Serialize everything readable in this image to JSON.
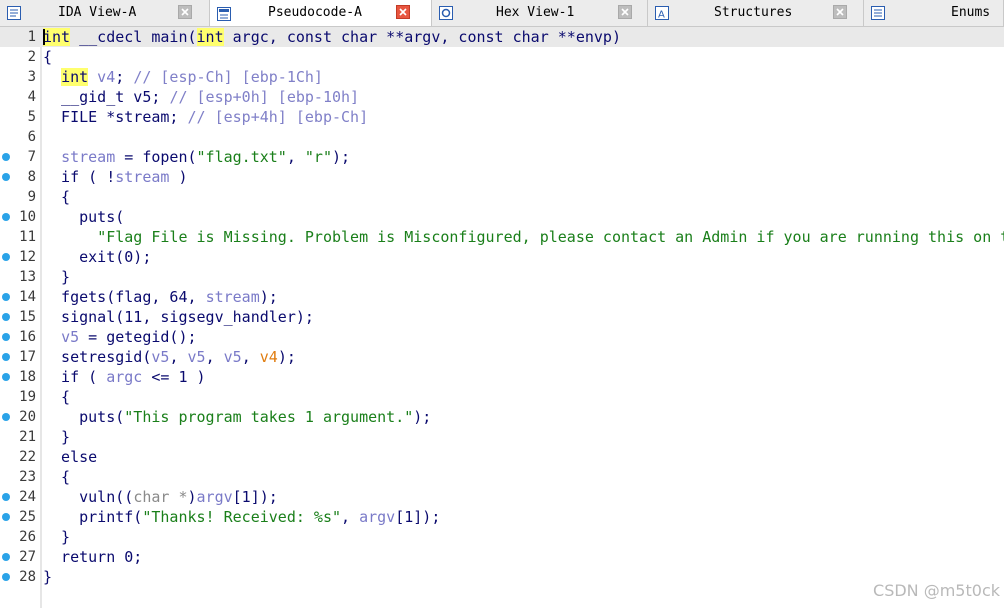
{
  "tabs": [
    {
      "label": "IDA View-A",
      "icon": "disassembly-view-icon",
      "close": "grey"
    },
    {
      "label": "Pseudocode-A",
      "icon": "pseudocode-icon",
      "close": "red",
      "active": true
    },
    {
      "label": "Hex View-1",
      "icon": "hex-view-icon",
      "close": "grey"
    },
    {
      "label": "Structures",
      "icon": "structures-icon",
      "close": "grey"
    },
    {
      "label": "Enums",
      "icon": "enums-icon",
      "close": "grey"
    }
  ],
  "colors": {
    "keyword_bg": "#ffff6e",
    "string": "#1a7f1a",
    "comment": "#8080c8",
    "breakpoint": "#2aa3e8",
    "close_active": "#e8553f"
  },
  "code": {
    "lines": [
      {
        "n": "1",
        "bp": false,
        "current": true,
        "tokens": [
          [
            "kw",
            "int"
          ],
          [
            "plain",
            " __cdecl main("
          ],
          [
            "kw",
            "int"
          ],
          [
            "plain",
            " argc, const char **argv, const char **envp)"
          ]
        ]
      },
      {
        "n": "2",
        "bp": false,
        "tokens": [
          [
            "plain",
            "{"
          ]
        ]
      },
      {
        "n": "3",
        "bp": false,
        "tokens": [
          [
            "plain",
            "  "
          ],
          [
            "kw",
            "int"
          ],
          [
            "var",
            " v4"
          ],
          [
            "plain",
            "; "
          ],
          [
            "cmt",
            "// [esp-Ch] [ebp-1Ch]"
          ]
        ]
      },
      {
        "n": "4",
        "bp": false,
        "tokens": [
          [
            "plain",
            "  __gid_t v5; "
          ],
          [
            "cmt",
            "// [esp+0h] [ebp-10h]"
          ]
        ]
      },
      {
        "n": "5",
        "bp": false,
        "tokens": [
          [
            "plain",
            "  FILE *stream; "
          ],
          [
            "cmt",
            "// [esp+4h] [ebp-Ch]"
          ]
        ]
      },
      {
        "n": "6",
        "bp": false,
        "tokens": []
      },
      {
        "n": "7",
        "bp": true,
        "tokens": [
          [
            "plain",
            "  "
          ],
          [
            "var",
            "stream"
          ],
          [
            "plain",
            " = fopen("
          ],
          [
            "str",
            "\"flag.txt\""
          ],
          [
            "plain",
            ", "
          ],
          [
            "str",
            "\"r\""
          ],
          [
            "plain",
            ");"
          ]
        ]
      },
      {
        "n": "8",
        "bp": true,
        "tokens": [
          [
            "plain",
            "  if ( !"
          ],
          [
            "var",
            "stream"
          ],
          [
            "plain",
            " )"
          ]
        ]
      },
      {
        "n": "9",
        "bp": false,
        "tokens": [
          [
            "plain",
            "  {"
          ]
        ]
      },
      {
        "n": "10",
        "bp": true,
        "tokens": [
          [
            "plain",
            "    puts("
          ]
        ]
      },
      {
        "n": "11",
        "bp": false,
        "tokens": [
          [
            "plain",
            "      "
          ],
          [
            "str",
            "\"Flag File is Missing. Problem is Misconfigured, please contact an Admin if you are running this on t"
          ]
        ]
      },
      {
        "n": "12",
        "bp": true,
        "tokens": [
          [
            "plain",
            "    exit(0);"
          ]
        ]
      },
      {
        "n": "13",
        "bp": false,
        "tokens": [
          [
            "plain",
            "  }"
          ]
        ]
      },
      {
        "n": "14",
        "bp": true,
        "tokens": [
          [
            "plain",
            "  fgets(flag, 64, "
          ],
          [
            "var",
            "stream"
          ],
          [
            "plain",
            ");"
          ]
        ]
      },
      {
        "n": "15",
        "bp": true,
        "tokens": [
          [
            "plain",
            "  signal(11, sigsegv_handler);"
          ]
        ]
      },
      {
        "n": "16",
        "bp": true,
        "tokens": [
          [
            "plain",
            "  "
          ],
          [
            "var",
            "v5"
          ],
          [
            "plain",
            " = getegid();"
          ]
        ]
      },
      {
        "n": "17",
        "bp": true,
        "tokens": [
          [
            "plain",
            "  setresgid("
          ],
          [
            "var",
            "v5"
          ],
          [
            "plain",
            ", "
          ],
          [
            "var",
            "v5"
          ],
          [
            "plain",
            ", "
          ],
          [
            "var",
            "v5"
          ],
          [
            "plain",
            ", "
          ],
          [
            "orange",
            "v4"
          ],
          [
            "plain",
            ");"
          ]
        ]
      },
      {
        "n": "18",
        "bp": true,
        "tokens": [
          [
            "plain",
            "  if ( "
          ],
          [
            "var",
            "argc"
          ],
          [
            "plain",
            " <= 1 )"
          ]
        ]
      },
      {
        "n": "19",
        "bp": false,
        "tokens": [
          [
            "plain",
            "  {"
          ]
        ]
      },
      {
        "n": "20",
        "bp": true,
        "tokens": [
          [
            "plain",
            "    puts("
          ],
          [
            "str",
            "\"This program takes 1 argument.\""
          ],
          [
            "plain",
            ");"
          ]
        ]
      },
      {
        "n": "21",
        "bp": false,
        "tokens": [
          [
            "plain",
            "  }"
          ]
        ]
      },
      {
        "n": "22",
        "bp": false,
        "tokens": [
          [
            "plain",
            "  else"
          ]
        ]
      },
      {
        "n": "23",
        "bp": false,
        "tokens": [
          [
            "plain",
            "  {"
          ]
        ]
      },
      {
        "n": "24",
        "bp": true,
        "tokens": [
          [
            "plain",
            "    vuln(("
          ],
          [
            "grey",
            "char *"
          ],
          [
            "plain",
            ")"
          ],
          [
            "var",
            "argv"
          ],
          [
            "plain",
            "[1]);"
          ]
        ]
      },
      {
        "n": "25",
        "bp": true,
        "tokens": [
          [
            "plain",
            "    printf("
          ],
          [
            "str",
            "\"Thanks! Received: %s\""
          ],
          [
            "plain",
            ", "
          ],
          [
            "var",
            "argv"
          ],
          [
            "plain",
            "[1]);"
          ]
        ]
      },
      {
        "n": "26",
        "bp": false,
        "tokens": [
          [
            "plain",
            "  }"
          ]
        ]
      },
      {
        "n": "27",
        "bp": true,
        "tokens": [
          [
            "plain",
            "  return 0;"
          ]
        ]
      },
      {
        "n": "28",
        "bp": true,
        "tokens": [
          [
            "plain",
            "}"
          ]
        ]
      }
    ]
  },
  "watermark": "CSDN @m5t0ck"
}
